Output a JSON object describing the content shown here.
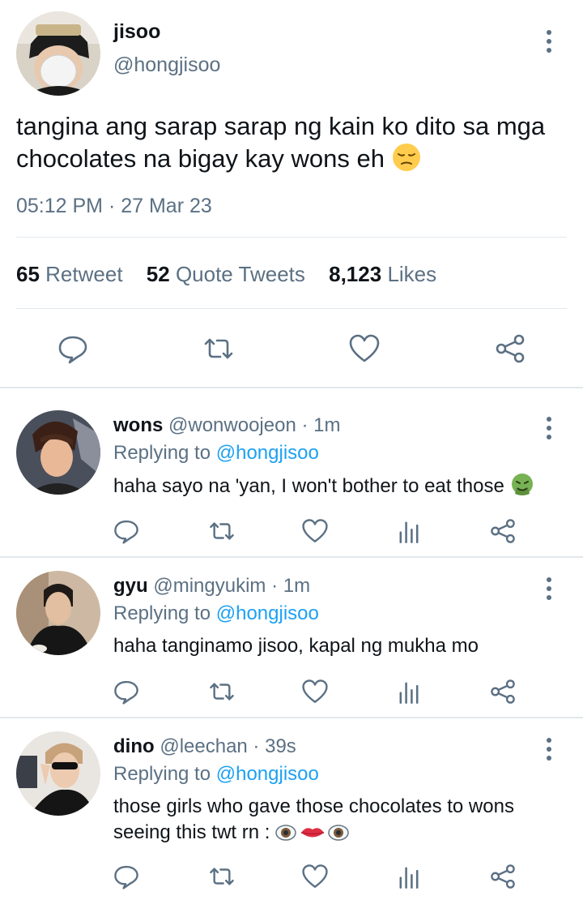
{
  "main_tweet": {
    "name": "jisoo",
    "handle": "@hongjisoo",
    "text": "tangina ang sarap sarap ng kain ko dito sa mga chocolates na bigay kay wons eh",
    "emoji": "pensive-face",
    "timestamp": "05:12 PM · 27 Mar 23",
    "stats": [
      {
        "count": "65",
        "label": "Retweet"
      },
      {
        "count": "52",
        "label": "Quote Tweets"
      },
      {
        "count": "8,123",
        "label": "Likes"
      }
    ]
  },
  "replies": [
    {
      "name": "wons",
      "handle": "@wonwoojeon",
      "separator": " · ",
      "time": "1m",
      "replying_prefix": "Replying to ",
      "replying_to": "@hongjisoo",
      "text": "haha sayo na 'yan, I won't bother to eat those",
      "emoji": "nauseated-face"
    },
    {
      "name": "gyu",
      "handle": "@mingyukim",
      "separator": " · ",
      "time": "1m",
      "replying_prefix": "Replying to ",
      "replying_to": "@hongjisoo",
      "text": "haha tanginamo jisoo, kapal ng mukha mo",
      "emoji": ""
    },
    {
      "name": "dino",
      "handle": "@leechan",
      "separator": " · ",
      "time": "39s",
      "replying_prefix": "Replying to ",
      "replying_to": "@hongjisoo",
      "text": "those girls who gave those chocolates to wons seeing this twt rn :",
      "emoji": "eyes-lips-eyes"
    }
  ],
  "colors": {
    "text": "#0f1419",
    "secondary": "#5b7083",
    "link": "#1da1f2",
    "divider": "#e1e8ed"
  }
}
